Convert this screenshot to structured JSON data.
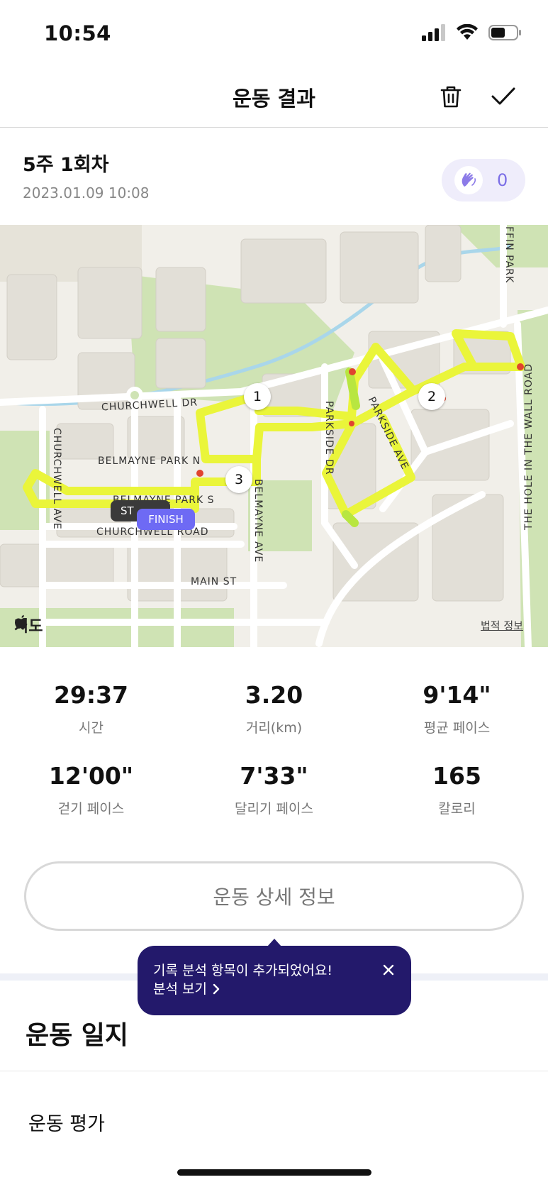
{
  "status_bar": {
    "time": "10:54"
  },
  "header": {
    "title": "운동 결과"
  },
  "session": {
    "title": "5주 1회차",
    "date": "2023.01.09 10:08",
    "clap_count": "0"
  },
  "map": {
    "streets": {
      "churchwell_dr": "CHURCHWELL DR",
      "churchwell_ave": "CHURCHWELL AVE",
      "belmayne_park_n": "BELMAYNE PARK N",
      "belmayne_park_s": "BELMAYNE PARK S",
      "belmayne_ave": "BELMAYNE AVE",
      "churchwell_road": "CHURCHWELL ROAD",
      "main_st": "MAIN ST",
      "parkside_dr": "PARKSIDE DR",
      "parkside_ave": "PARKSIDE AVE",
      "griffin_park": "FFIN PARK",
      "hole_in_wall": "THE HOLE IN THE WALL ROAD"
    },
    "split_markers": [
      "1",
      "2",
      "3"
    ],
    "start_label": "ST",
    "finish_label": "FINISH",
    "attribution": "지도",
    "legal_link": "법적 정보",
    "route_color": "#eaf53a"
  },
  "stats": [
    {
      "value": "29:37",
      "label": "시간"
    },
    {
      "value": "3.20",
      "label": "거리(km)"
    },
    {
      "value": "9'14\"",
      "label": "평균 페이스"
    },
    {
      "value": "12'00\"",
      "label": "걷기 페이스"
    },
    {
      "value": "7'33\"",
      "label": "달리기 페이스"
    },
    {
      "value": "165",
      "label": "칼로리"
    }
  ],
  "details_button": "운동 상세 정보",
  "tooltip": {
    "message": "기록 분석 항목이 추가되었어요!",
    "link": "분석 보기"
  },
  "journal": {
    "title": "운동 일지",
    "rating": "운동 평가"
  },
  "colors": {
    "accent": "#7b6ee6",
    "tooltip_bg": "#23196b",
    "finish": "#6e6af4"
  }
}
